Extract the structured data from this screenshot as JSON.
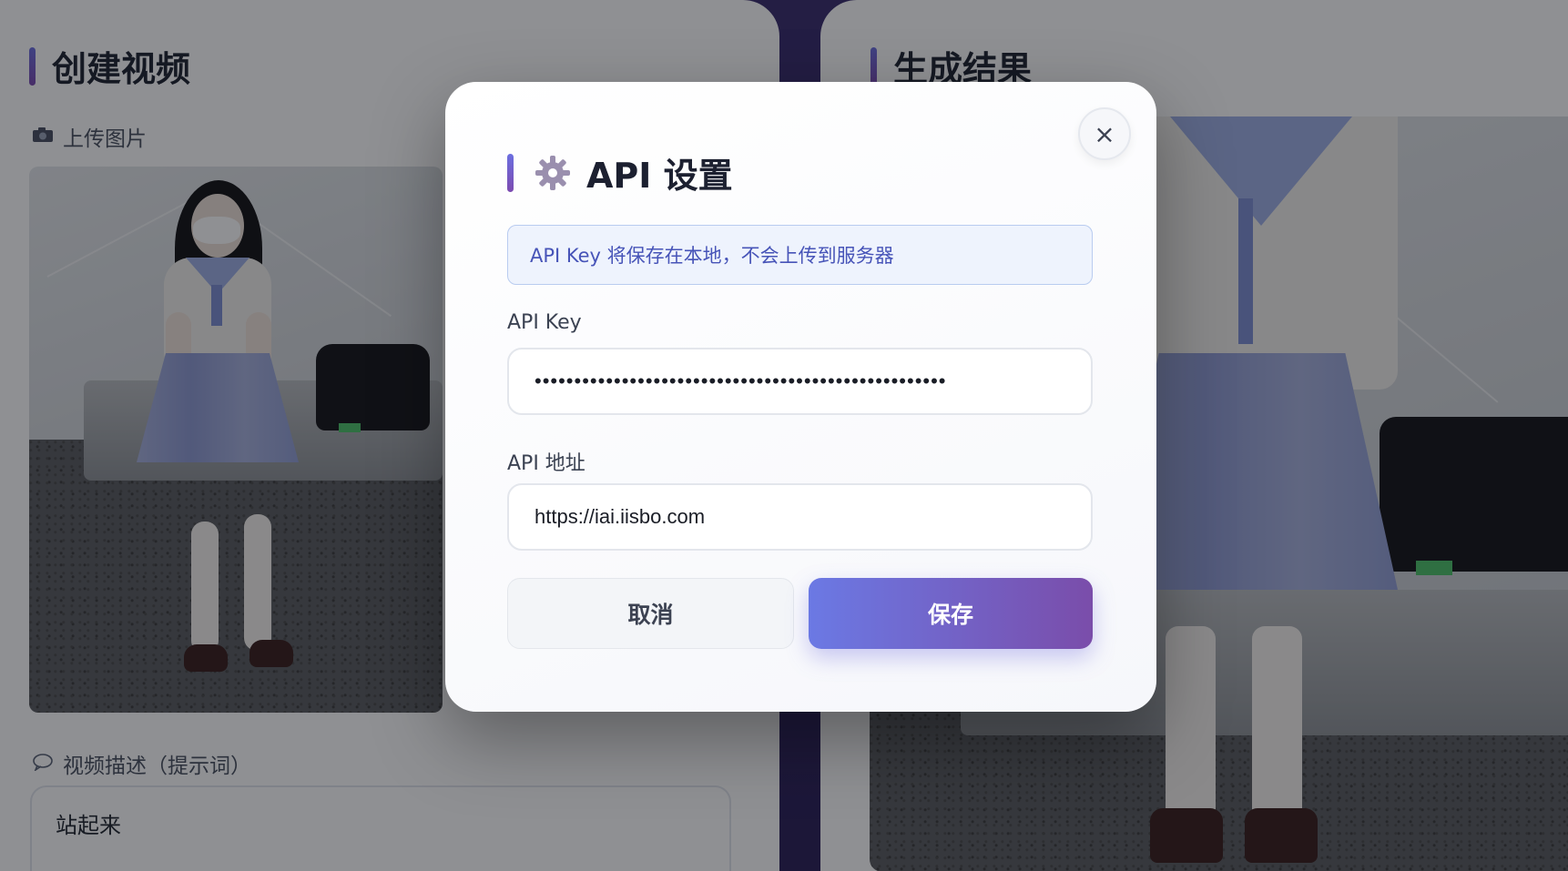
{
  "left_panel": {
    "title": "创建视频",
    "upload_label": "上传图片",
    "upload_icon": "camera-icon",
    "prompt_label": "视频描述（提示词）",
    "prompt_icon": "speech-bubble-icon",
    "prompt_value": "站起来"
  },
  "right_panel": {
    "title": "生成结果"
  },
  "modal": {
    "title": "API 设置",
    "title_icon": "gear-icon",
    "close_symbol": "×",
    "notice": "API Key 将保存在本地，不会上传到服务器",
    "api_key_label": "API Key",
    "api_key_value": "••••••••••••••••••••••••••••••••••••••••••••••••••••",
    "api_url_label": "API 地址",
    "api_url_value": "https://iai.iisbo.com",
    "cancel_label": "取消",
    "save_label": "保存"
  },
  "colors": {
    "accent_start": "#6b79e4",
    "accent_end": "#7a4daa",
    "notice_text": "#4754b8",
    "notice_bg": "#eef3fd"
  }
}
